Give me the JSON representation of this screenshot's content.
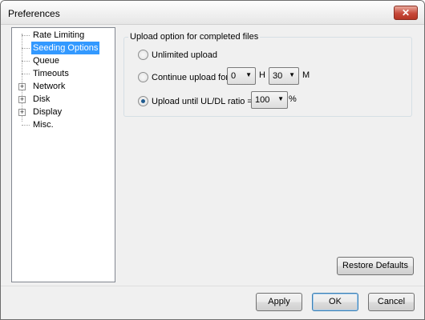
{
  "window": {
    "title": "Preferences",
    "close_label": "✕"
  },
  "tree": {
    "items": [
      {
        "label": "Rate Limiting",
        "expandable": false,
        "expander": ""
      },
      {
        "label": "Seeding Options",
        "expandable": false,
        "expander": "",
        "selected": true
      },
      {
        "label": "Queue",
        "expandable": false,
        "expander": ""
      },
      {
        "label": "Timeouts",
        "expandable": false,
        "expander": ""
      },
      {
        "label": "Network",
        "expandable": true,
        "expander": "+"
      },
      {
        "label": "Disk",
        "expandable": true,
        "expander": "+"
      },
      {
        "label": "Display",
        "expandable": true,
        "expander": "+"
      },
      {
        "label": "Misc.",
        "expandable": false,
        "expander": ""
      }
    ]
  },
  "upload": {
    "group_title": "Upload option for completed files",
    "unlimited_label": "Unlimited upload",
    "continue_label": "Continue upload for",
    "hours_value": "0",
    "hours_unit": "H",
    "minutes_value": "30",
    "minutes_unit": "M",
    "ratio_label": "Upload until UL/DL ratio =",
    "ratio_value": "100",
    "ratio_unit": "%",
    "selected_option": "ratio"
  },
  "buttons": {
    "restore_defaults": "Restore Defaults",
    "apply": "Apply",
    "ok": "OK",
    "cancel": "Cancel"
  }
}
